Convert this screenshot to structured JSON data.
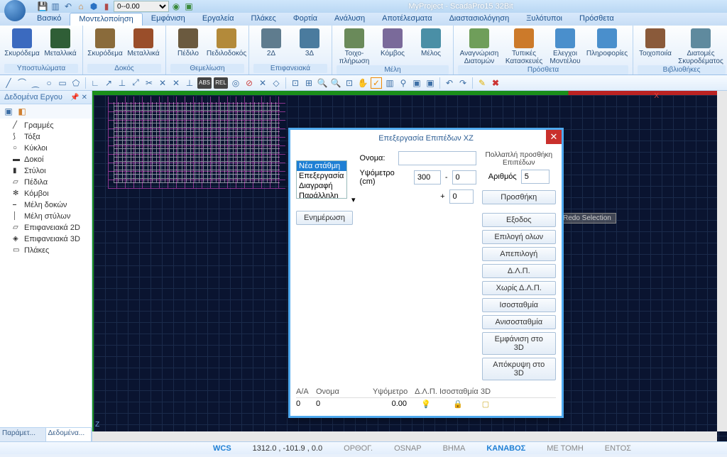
{
  "app": {
    "title": "MyProject - ScadaPro15 32Bit"
  },
  "qat": {
    "dropdown_value": "0--0.00"
  },
  "ribbon": {
    "tabs": [
      "Βασικό",
      "Μοντελοποίηση",
      "Εμφάνιση",
      "Εργαλεία",
      "Πλάκες",
      "Φορτία",
      "Ανάλυση",
      "Αποτέλεσματα",
      "Διαστασιολόγηση",
      "Ξυλότυποι",
      "Πρόσθετα"
    ],
    "active_tab": 1,
    "groups": [
      {
        "label": "Υποστυλώματα",
        "buttons": [
          {
            "label": "Σκυρόδεμα"
          },
          {
            "label": "Μεταλλικά"
          }
        ]
      },
      {
        "label": "Δοκός",
        "buttons": [
          {
            "label": "Σκυρόδεμα"
          },
          {
            "label": "Μεταλλικά"
          }
        ]
      },
      {
        "label": "Θεμελίωση",
        "buttons": [
          {
            "label": "Πέδιλο"
          },
          {
            "label": "Πεδιλοδοκός"
          }
        ]
      },
      {
        "label": "Επιφανειακά",
        "buttons": [
          {
            "label": "2Δ"
          },
          {
            "label": "3Δ"
          }
        ]
      },
      {
        "label": "Μέλη",
        "buttons": [
          {
            "label": "Τοιχο-πλήρωση"
          },
          {
            "label": "Κόμβος"
          },
          {
            "label": "Μέλος"
          }
        ]
      },
      {
        "label": "Πρόσθετα",
        "buttons": [
          {
            "label": "Αναγνώριση Διατομών"
          },
          {
            "label": "Τυπικές Κατασκευές"
          },
          {
            "label": "Ελεγχοι Μοντέλου"
          },
          {
            "label": "Πληροφορίες"
          }
        ]
      },
      {
        "label": "Βιβλιοθήκες",
        "buttons": [
          {
            "label": "Τοιχοποιία"
          },
          {
            "label": "Διατομές Σκυροδέματος"
          }
        ]
      }
    ]
  },
  "project_panel": {
    "title": "Δεδομένα Εργου",
    "items": [
      "Γραμμές",
      "Τόξα",
      "Κύκλοι",
      "Δοκοί",
      "Στύλοι",
      "Πέδιλα",
      "Κόμβοι",
      "Μέλη δοκών",
      "Μέλη στύλων",
      "Επιφανειακά 2D",
      "Επιφανειακά 3D",
      "Πλάκες"
    ],
    "tabs": [
      "Παράμετ...",
      "Δεδομένα..."
    ],
    "active_tab": 1
  },
  "canvas": {
    "hint": "Redo Selection",
    "axis_x": "X",
    "axis_z": "Z"
  },
  "dialog": {
    "title": "Επεξεργασία Επιπέδων XZ",
    "list_options": [
      "Νέα στάθμη",
      "Επεξεργασία",
      "Διαγραφή",
      "Παράλληλη μετακί"
    ],
    "list_selected": 0,
    "name_label": "Ονομα:",
    "name_value": "",
    "height_label": "Υψόμετρο (cm)",
    "height_value": "300",
    "height_minus": "0",
    "height_plus": "0",
    "update_btn": "Ενημέρωση",
    "multi_label": "Πολλαπλή προσθήκη Επιπέδων",
    "count_label": "Αριθμός",
    "count_value": "5",
    "add_btn": "Προσθήκη",
    "side_buttons": [
      "Εξοδος",
      "Επιλογή ολων",
      "Απεπιλογή",
      "Δ.Λ.Π.",
      "Χωρίς Δ.Λ.Π.",
      "Ισοσταθμία",
      "Ανισοσταθμία",
      "Εμφάνιση στο 3D",
      "Απόκρυψη στο 3D"
    ],
    "table": {
      "headers": [
        "Α/Α",
        "Ονομα",
        "Υψόμετρο",
        "Δ.Λ.Π.",
        "Ισοσταθμία",
        "3D"
      ],
      "rows": [
        {
          "aa": "0",
          "name": "0",
          "height": "0.00",
          "dlp": "💡",
          "iso": "🔒",
          "td": "▢"
        }
      ]
    }
  },
  "statusbar": {
    "wcs": "WCS",
    "coords": "1312.0 , -101.9 , 0.0",
    "items": [
      "ΟΡΘΟΓ.",
      "OSNAP",
      "ΒΗΜΑ",
      "ΚΑΝΑΒΟΣ",
      "ΜΕ ΤΟΜΗ",
      "ΕΝΤΟΣ"
    ],
    "active_item": 3
  },
  "icon_colors": {
    "col1": "#3b6abf",
    "col2": "#2f5e36",
    "col3": "#8a6b3b",
    "col4": "#9a4e2a",
    "col5": "#6b5a3f",
    "col6": "#b38a3a",
    "col7": "#5f7c8e",
    "col8": "#4a7b9e",
    "col9": "#6a8a5a",
    "col10": "#7a6a9a",
    "col11": "#4a8fa6",
    "col12": "#6f9e5a",
    "col13": "#cc7a2a",
    "col14": "#4a8fcc",
    "col15": "#8a5a3a",
    "col16": "#5f8a9e"
  }
}
